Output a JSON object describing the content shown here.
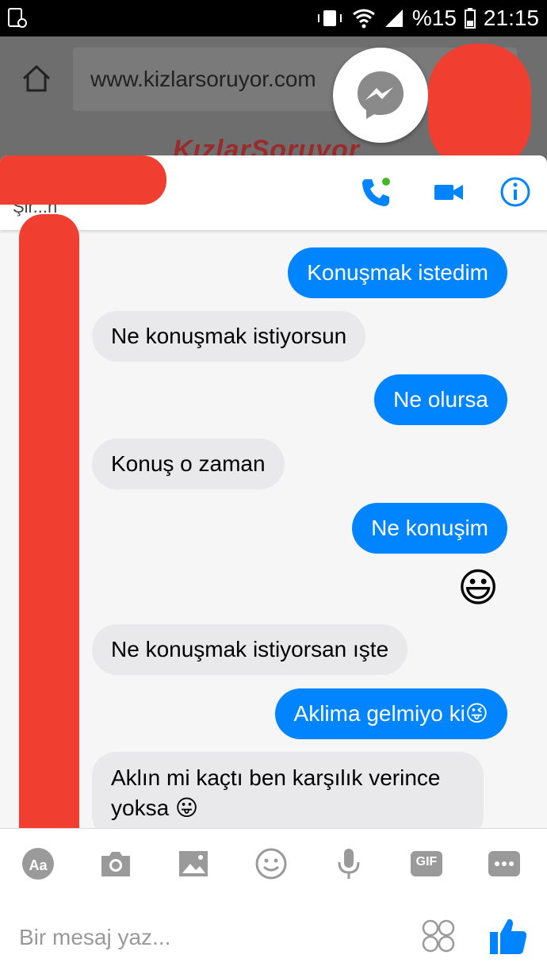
{
  "status_bar": {
    "battery": "%15",
    "time": "21:15"
  },
  "browser": {
    "url": "www.kizlarsoruyor.com",
    "site_logo": "KızlarSoruyor"
  },
  "chat": {
    "contact_hint": "Şir...n",
    "messages": [
      {
        "dir": "out",
        "text": "Konuşmak istedim"
      },
      {
        "dir": "in",
        "text": "Ne konuşmak istiyorsun"
      },
      {
        "dir": "out",
        "text": "Ne olursa"
      },
      {
        "dir": "in",
        "text": "Konuş o zaman"
      },
      {
        "dir": "out",
        "text": "Ne konuşim"
      },
      {
        "dir": "out",
        "text": "😃"
      },
      {
        "dir": "in",
        "text": "Ne konuşmak istiyorsan ışte"
      },
      {
        "dir": "out",
        "text": "Aklima gelmiyo ki😜"
      },
      {
        "dir": "in",
        "text": "Aklın mi kaçtı ben karşılık verince yoksa 😛"
      }
    ]
  },
  "composer": {
    "placeholder": "Bir mesaj yaz...",
    "tools": [
      "aa-icon",
      "camera-icon",
      "image-icon",
      "smiley-icon",
      "microphone-icon",
      "gif-icon",
      "more-icon"
    ],
    "gif_label": "GIF"
  },
  "colors": {
    "messenger_blue": "#0084ff",
    "incoming_bubble": "#e9e9eb",
    "redaction": "#f03e31"
  }
}
